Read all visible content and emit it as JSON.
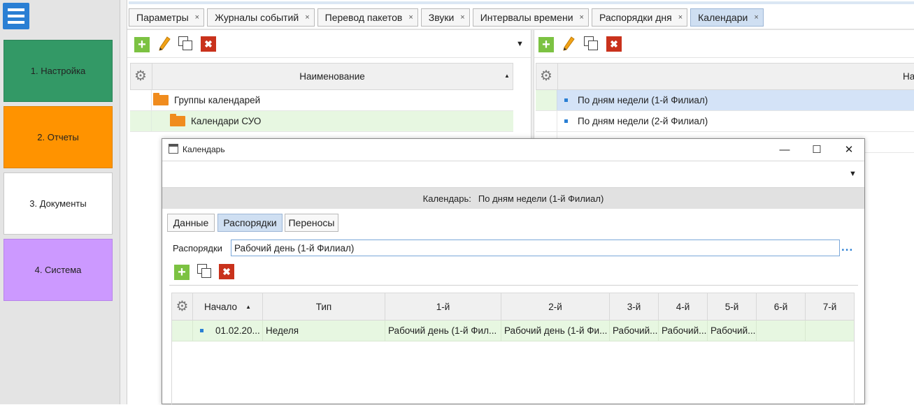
{
  "sidebar": {
    "items": [
      {
        "label": "1. Настройка",
        "color": "#339966"
      },
      {
        "label": "2. Отчеты",
        "color": "#ff9300"
      },
      {
        "label": "3. Документы",
        "color": "#ffffff"
      },
      {
        "label": "4. Система",
        "color": "#cc99ff"
      }
    ]
  },
  "tabs": [
    {
      "label": "Параметры"
    },
    {
      "label": "Журналы событий"
    },
    {
      "label": "Перевод пакетов"
    },
    {
      "label": "Звуки"
    },
    {
      "label": "Интервалы времени"
    },
    {
      "label": "Распорядки дня"
    },
    {
      "label": "Календари",
      "active": true
    }
  ],
  "tab_close_glyph": "×",
  "left_panel": {
    "column_header": "Наименование",
    "sort_glyph": "▲",
    "rows": [
      {
        "label": "Группы календарей",
        "icon": "folder-icon"
      },
      {
        "label": "Календари СУО",
        "icon": "folder-icon"
      }
    ]
  },
  "right_panel": {
    "column_header": "На",
    "rows": [
      {
        "label": "По дням недели (1-й Филиал)"
      },
      {
        "label": "По дням недели (2-й Филиал)"
      }
    ]
  },
  "dialog": {
    "title": "Календарь",
    "header_label": "Календарь:",
    "header_value": "По дням недели (1-й Филиал)",
    "subtabs": [
      {
        "label": "Данные"
      },
      {
        "label": "Распорядки",
        "active": true
      },
      {
        "label": "Переносы"
      }
    ],
    "field_label": "Распорядки",
    "field_value": "Рабочий день (1-й Филиал)",
    "ellipsis": "...",
    "columns": [
      "Начало",
      "Тип",
      "1-й",
      "2-й",
      "3-й",
      "4-й",
      "5-й",
      "6-й",
      "7-й"
    ],
    "sort_glyph": "▲",
    "rows": [
      {
        "start": "01.02.20...",
        "type": "Неделя",
        "d1": "Рабочий день (1-й Фил...",
        "d2": "Рабочий день (1-й Фи...",
        "d3": "Рабочий...",
        "d4": "Рабочий...",
        "d5": "Рабочий...",
        "d6": "",
        "d7": ""
      }
    ]
  },
  "glyphs": {
    "dropdown": "▼",
    "minimize": "—",
    "maximize": "☐",
    "close": "✕",
    "add": "+",
    "delete": "✖",
    "gear": "⚙"
  },
  "colors": {
    "accent_blue": "#2a7fd4",
    "row_selected_blue": "#d4e3f7",
    "row_selected_green": "#e7f7e1",
    "add_green": "#7cc242",
    "delete_red": "#c9321c",
    "folder_orange": "#f08c1e"
  }
}
